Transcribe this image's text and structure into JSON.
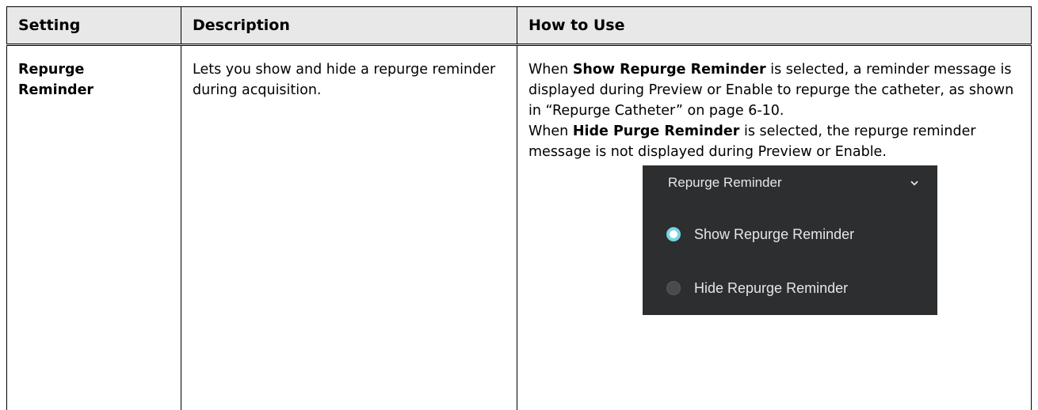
{
  "table": {
    "headers": {
      "setting": "Setting",
      "description": "Description",
      "how_to_use": "How to Use"
    },
    "rows": [
      {
        "setting_line1": "Repurge",
        "setting_line2": "Reminder",
        "description": "Lets you show and hide a repurge reminder during acquisition.",
        "how_to_use": {
          "p1_pre": "When ",
          "p1_bold": "Show Repurge Reminder",
          "p1_post": " is selected, a reminder message is displayed during Preview or Enable to repurge the catheter, as shown in “Repurge Catheter” on page 6-10.",
          "p2_pre": "When ",
          "p2_bold": "Hide Purge Reminder",
          "p2_post": " is selected, the repurge reminder message is not displayed during Preview or Enable."
        },
        "screenshot": {
          "title": "Repurge Reminder",
          "chevron_icon": "chevron-down-icon",
          "options": [
            {
              "label": "Show Repurge Reminder",
              "selected": true
            },
            {
              "label": "Hide Repurge Reminder",
              "selected": false
            }
          ],
          "colors": {
            "panel_bg": "#2c2e30",
            "text": "#e4e6e8",
            "radio_selected_ring": "#79d3e3",
            "radio_unselected": "#4a4b4e"
          }
        }
      }
    ]
  }
}
